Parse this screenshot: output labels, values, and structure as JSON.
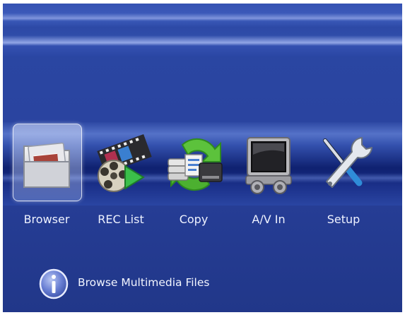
{
  "menu": {
    "items": [
      {
        "label": "Browser",
        "icon": "folder-icon",
        "selected": true
      },
      {
        "label": "REC List",
        "icon": "film-reel-icon",
        "selected": false
      },
      {
        "label": "Copy",
        "icon": "copy-sync-icon",
        "selected": false
      },
      {
        "label": "A/V In",
        "icon": "tv-monitor-icon",
        "selected": false
      },
      {
        "label": "Setup",
        "icon": "tools-icon",
        "selected": false
      }
    ]
  },
  "info": {
    "icon": "info-icon",
    "text": "Browse Multimedia Files"
  },
  "colors": {
    "background": "#2a44a0",
    "band_dark": "#0f2170",
    "label_text": "#eef2ff"
  }
}
